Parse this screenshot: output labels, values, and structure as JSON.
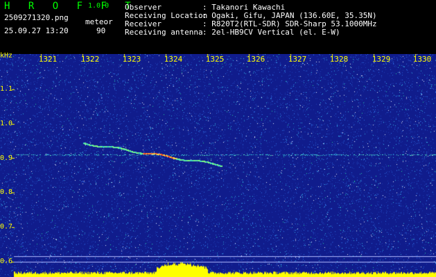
{
  "app": {
    "name": "H R O F F T",
    "version": "1.0.0"
  },
  "file": {
    "filename": "2509271320.png",
    "datetime": "25.09.27 13:20",
    "mode_label": "meteor",
    "mode_value": "90"
  },
  "station": {
    "rows": [
      {
        "label": "Observer",
        "value": ": Takanori Kawachi"
      },
      {
        "label": "Receiving Location",
        "value": ": Ogaki, Gifu, JAPAN (136.60E, 35.35N)"
      },
      {
        "label": "Receiver",
        "value": ": R820T2(RTL-SDR) SDR-Sharp 53.1000MHz"
      },
      {
        "label": "Receiving antenna",
        "value": ": 2el-HB9CV Vertical (el. E-W)"
      }
    ]
  },
  "axes": {
    "y_unit": "kHz",
    "y_ticks": [
      "1.1",
      "1.0",
      "0.9",
      "0.8",
      "0.7",
      "0.6"
    ],
    "x_ticks": [
      "1321",
      "1322",
      "1323",
      "1324",
      "1325",
      "1326",
      "1327",
      "1328",
      "1329",
      "1330"
    ]
  },
  "colors": {
    "background": "#101c8c",
    "label": "#ffff00",
    "header_text": "#ffffff",
    "brand": "#00ff00"
  }
}
